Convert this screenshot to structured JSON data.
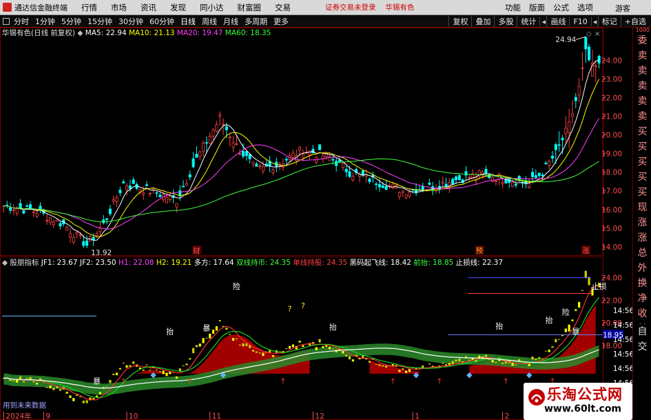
{
  "titlebar": {
    "app_title": "通达信金融终端",
    "menus": [
      "行情",
      "市场",
      "资讯",
      "发现",
      "同小达",
      "财富圈",
      "交易"
    ],
    "login_status": "证券交易未登录",
    "stock_tag": "华锡有色",
    "right_menus": [
      "功能",
      "版面",
      "公式",
      "选项"
    ],
    "guest": "游客"
  },
  "toolbar": {
    "periods": [
      "分时",
      "1分钟",
      "5分钟",
      "15分钟",
      "30分钟",
      "60分钟",
      "日线",
      "周线",
      "月线",
      "多周期",
      "更多"
    ],
    "active_period": "日线",
    "right_buttons": [
      "复权",
      "叠加",
      "多股",
      "统计",
      "画线",
      "F10",
      "标记",
      "+自选"
    ]
  },
  "side_panel": {
    "items": [
      "委比",
      "卖五",
      "卖四",
      "卖三",
      "卖二",
      "卖一",
      "买一",
      "买二",
      "买三",
      "买四",
      "买五",
      "现价",
      "涨跌",
      "涨幅",
      "总量",
      "外盘",
      "换手",
      "净资",
      "收益",
      "自动",
      "交易"
    ],
    "top_mark": "1000"
  },
  "watermark": {
    "title": "乐淘公式网",
    "url": "www.60lt.com"
  },
  "future_note": "用到未来数据",
  "chart_data": [
    {
      "type": "candlestick",
      "stock": "华锡有色",
      "period_label": "(日线 前复权)",
      "legend": [
        {
          "name": "MA5",
          "value": "22.94",
          "color": "#ffffff"
        },
        {
          "name": "MA10",
          "value": "21.13",
          "color": "#ffff00"
        },
        {
          "name": "MA20",
          "value": "19.47",
          "color": "#ff40ff"
        },
        {
          "name": "MA60",
          "value": "18.35",
          "color": "#40ff40"
        }
      ],
      "ylim": [
        13.7,
        25.6
      ],
      "yticks": [
        14.0,
        15.0,
        16.0,
        17.0,
        18.0,
        19.0,
        20.0,
        21.0,
        22.0,
        23.0,
        24.0
      ],
      "high_label": "24.94",
      "low_label": "13.92",
      "markers": [
        {
          "text": "财",
          "index": 58
        },
        {
          "text": "预",
          "index": 143
        },
        {
          "text": "涨",
          "index": 175
        }
      ],
      "candles_anchor": [
        [
          0,
          16.2
        ],
        [
          10,
          15.9
        ],
        [
          18,
          15.2
        ],
        [
          25,
          14.1
        ],
        [
          30,
          15.2
        ],
        [
          36,
          17.4
        ],
        [
          44,
          17.0
        ],
        [
          52,
          16.5
        ],
        [
          58,
          18.7
        ],
        [
          65,
          20.9
        ],
        [
          70,
          19.4
        ],
        [
          76,
          18.1
        ],
        [
          82,
          18.4
        ],
        [
          90,
          19.2
        ],
        [
          98,
          18.8
        ],
        [
          104,
          18.0
        ],
        [
          112,
          17.5
        ],
        [
          120,
          17.0
        ],
        [
          128,
          17.2
        ],
        [
          136,
          17.6
        ],
        [
          144,
          17.9
        ],
        [
          152,
          17.6
        ],
        [
          158,
          17.4
        ],
        [
          162,
          18.0
        ],
        [
          166,
          19.0
        ],
        [
          170,
          20.5
        ],
        [
          173,
          22.5
        ],
        [
          175,
          24.4
        ],
        [
          177,
          23.6
        ]
      ]
    },
    {
      "type": "indicator",
      "name": "股朋指标",
      "legend": [
        {
          "name": "JF1",
          "value": "23.67",
          "color": "#ffffff"
        },
        {
          "name": "JF2",
          "value": "23.50",
          "color": "#ffffff"
        },
        {
          "name": "H1",
          "value": "22.08",
          "color": "#ff40ff"
        },
        {
          "name": "H2",
          "value": "19.21",
          "color": "#ffff00"
        },
        {
          "name": "多方",
          "value": "17.64",
          "color": "#ffffff"
        },
        {
          "name": "双线持币",
          "value": "24.35",
          "color": "#40ff40"
        },
        {
          "name": "单线持股",
          "value": "24.35",
          "color": "#ff4040"
        },
        {
          "name": "黑码起飞线",
          "value": "18.42",
          "color": "#ffffff"
        },
        {
          "name": "前抬",
          "value": "18.85",
          "color": "#40ff40"
        },
        {
          "name": "止损线",
          "value": "22.37",
          "color": "#ffffff"
        }
      ],
      "ylim": [
        12.5,
        25.5
      ],
      "yticks": [
        18.0,
        20.0,
        22.0,
        24.0
      ],
      "price_tag": "18.95",
      "labels": [
        {
          "text": "抬",
          "index": 50,
          "value": 19.0
        },
        {
          "text": "抬",
          "index": 99,
          "value": 19.4
        },
        {
          "text": "抬",
          "index": 149,
          "value": 19.5
        },
        {
          "text": "抬",
          "index": 164,
          "value": 20.0
        },
        {
          "text": "险",
          "index": 70,
          "value": 23.0
        },
        {
          "text": "险",
          "index": 169,
          "value": 20.7
        },
        {
          "text": "止损",
          "index": 179,
          "value": 23.0
        },
        {
          "text": "暴",
          "index": 61,
          "value": 19.3
        },
        {
          "text": "暴",
          "index": 172,
          "value": 19.0
        },
        {
          "text": "暴",
          "index": 28,
          "value": 14.6
        },
        {
          "text": "?",
          "index": 86,
          "value": 21.0
        },
        {
          "text": "?",
          "index": 90,
          "value": 21.3
        }
      ],
      "month_labels": [
        {
          "text": "2024年",
          "index": 0
        },
        {
          "text": "9",
          "index": 12
        },
        {
          "text": "10",
          "index": 37
        },
        {
          "text": "11",
          "index": 62
        },
        {
          "text": "12",
          "index": 93
        },
        {
          "text": "1",
          "index": 123
        },
        {
          "text": "2",
          "index": 150
        }
      ],
      "right_time_labels": [
        "14:56",
        "14:56",
        "14:56",
        "14:56",
        "14:56",
        "14:56",
        "14:56"
      ]
    }
  ],
  "colors": {
    "up": "#ff4040",
    "down": "#00ffff",
    "grid": "#7a0000",
    "axis_text": "#ff5050"
  }
}
